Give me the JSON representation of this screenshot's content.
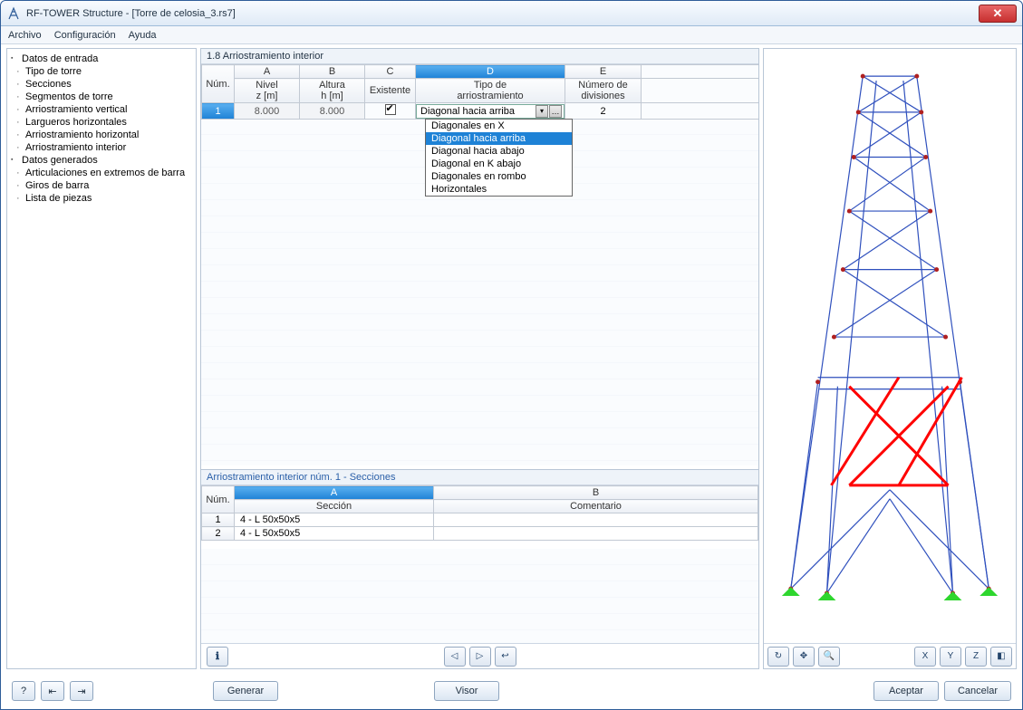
{
  "window": {
    "title": "RF-TOWER Structure - [Torre de celosia_3.rs7]"
  },
  "menu": {
    "file": "Archivo",
    "config": "Configuración",
    "help": "Ayuda"
  },
  "tree": {
    "inputs_header": "Datos de entrada",
    "inputs": [
      "Tipo de torre",
      "Secciones",
      "Segmentos de torre",
      "Arriostramiento vertical",
      "Largueros horizontales",
      "Arriostramiento horizontal",
      "Arriostramiento interior"
    ],
    "generated_header": "Datos generados",
    "generated": [
      "Articulaciones en extremos de barra",
      "Giros de barra",
      "Lista de piezas"
    ]
  },
  "main_grid": {
    "title": "1.8 Arriostramiento interior",
    "cols_letters": [
      "A",
      "B",
      "C",
      "D",
      "E"
    ],
    "rowhdr": "Núm.",
    "h_a1": "Nivel",
    "h_a2": "z [m]",
    "h_b1": "Altura",
    "h_b2": "h [m]",
    "h_c": "Existente",
    "h_d1": "Tipo de",
    "h_d2": "arriostramiento",
    "h_e1": "Número de",
    "h_e2": "divisiones",
    "row": {
      "idx": "1",
      "z": "8.000",
      "h": "8.000",
      "existente": true,
      "tipo": "Diagonal hacia arriba",
      "div": "2"
    },
    "dropdown": {
      "options": [
        "Diagonales en X",
        "Diagonal hacia arriba",
        "Diagonal hacia abajo",
        "Diagonal en K abajo",
        "Diagonales en rombo",
        "Horizontales"
      ],
      "selected_index": 1
    }
  },
  "sections": {
    "title": "Arriostramiento interior núm. 1 - Secciones",
    "col_num": "Núm.",
    "col_a": "A",
    "col_b": "B",
    "h_sec": "Sección",
    "h_com": "Comentario",
    "rows": [
      {
        "idx": "1",
        "sec": "4 - L 50x50x5",
        "com": ""
      },
      {
        "idx": "2",
        "sec": "4 - L 50x50x5",
        "com": ""
      }
    ]
  },
  "viewer_tools": {
    "rot": "↻",
    "move": "✥",
    "zoom": "🔍",
    "ax_x": "X",
    "ax_y": "Y",
    "ax_z": "Z",
    "iso": "◧"
  },
  "footer": {
    "help": "?",
    "in": "⇤",
    "out": "⇥",
    "gen": "Generar",
    "viewer": "Visor",
    "ok": "Aceptar",
    "cancel": "Cancelar"
  },
  "nav": {
    "info": "ℹ",
    "prev": "◁",
    "next": "▷",
    "link": "↩"
  }
}
